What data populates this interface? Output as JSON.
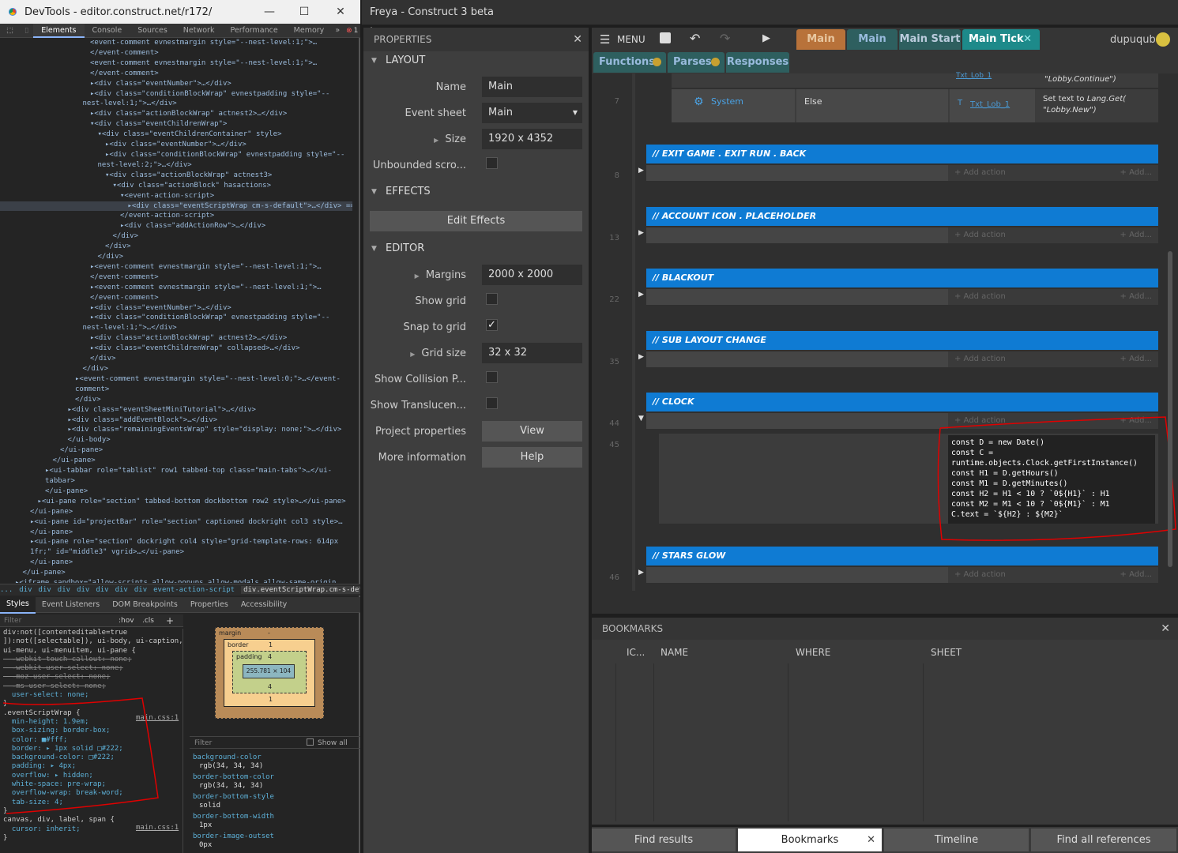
{
  "devtools": {
    "title": "DevTools - editor.construct.net/r172/",
    "tabs": [
      "Elements",
      "Console",
      "Sources",
      "Network",
      "Performance",
      "Memory",
      "»"
    ],
    "error_count": "1",
    "dom_lines": [
      {
        "i": 12,
        "t": "<event-comment evnestmargin style=\"--nest-level:1;\">…"
      },
      {
        "i": 12,
        "t": "</event-comment>"
      },
      {
        "i": 12,
        "t": "<event-comment evnestmargin style=\"--nest-level:1;\">…"
      },
      {
        "i": 12,
        "t": "</event-comment>"
      },
      {
        "i": 12,
        "t": "▸<div class=\"eventNumber\">…</div>"
      },
      {
        "i": 12,
        "t": "▸<div class=\"conditionBlockWrap\" evnestpadding style=\"--"
      },
      {
        "i": 11,
        "t": "nest-level:1;\">…</div>"
      },
      {
        "i": 12,
        "t": "▸<div class=\"actionBlockWrap\" actnest2>…</div>"
      },
      {
        "i": 12,
        "t": "▾<div class=\"eventChildrenWrap\">"
      },
      {
        "i": 13,
        "t": "▾<div class=\"eventChildrenContainer\" style>"
      },
      {
        "i": 14,
        "t": "▸<div class=\"eventNumber\">…</div>"
      },
      {
        "i": 14,
        "t": "▸<div class=\"conditionBlockWrap\" evnestpadding style=\"--"
      },
      {
        "i": 13,
        "t": "nest-level:2;\">…</div>"
      },
      {
        "i": 14,
        "t": "▾<div class=\"actionBlockWrap\" actnest3>"
      },
      {
        "i": 15,
        "t": "▾<div class=\"actionBlock\" hasactions>"
      },
      {
        "i": 16,
        "t": "▾<event-action-script>"
      },
      {
        "i": 17,
        "t": "▸<div class=\"eventScriptWrap cm-s-default\">…</div> =="
      },
      {
        "i": 16,
        "t": "</event-action-script>"
      },
      {
        "i": 16,
        "t": "▸<div class=\"addActionRow\">…</div>"
      },
      {
        "i": 15,
        "t": "</div>"
      },
      {
        "i": 14,
        "t": "</div>"
      },
      {
        "i": 13,
        "t": "</div>"
      },
      {
        "i": 12,
        "t": "▸<event-comment evnestmargin style=\"--nest-level:1;\">…"
      },
      {
        "i": 12,
        "t": "</event-comment>"
      },
      {
        "i": 12,
        "t": "▸<event-comment evnestmargin style=\"--nest-level:1;\">…"
      },
      {
        "i": 12,
        "t": "</event-comment>"
      },
      {
        "i": 12,
        "t": "▸<div class=\"eventNumber\">…</div>"
      },
      {
        "i": 12,
        "t": "▸<div class=\"conditionBlockWrap\" evnestpadding style=\"--"
      },
      {
        "i": 11,
        "t": "nest-level:1;\">…</div>"
      },
      {
        "i": 12,
        "t": "▸<div class=\"actionBlockWrap\" actnest2>…</div>"
      },
      {
        "i": 12,
        "t": "▸<div class=\"eventChildrenWrap\" collapsed>…</div>"
      },
      {
        "i": 12,
        "t": "</div>"
      },
      {
        "i": 11,
        "t": "</div>"
      },
      {
        "i": 10,
        "t": "▸<event-comment evnestmargin style=\"--nest-level:0;\">…</event-"
      },
      {
        "i": 10,
        "t": "comment>"
      },
      {
        "i": 10,
        "t": "</div>"
      },
      {
        "i": 9,
        "t": "▸<div class=\"eventSheetMiniTutorial\">…</div>"
      },
      {
        "i": 9,
        "t": "▸<div class=\"addEventBlock\">…</div>"
      },
      {
        "i": 9,
        "t": "▸<div class=\"remainingEventsWrap\" style=\"display: none;\">…</div>"
      },
      {
        "i": 9,
        "t": "</ui-body>"
      },
      {
        "i": 8,
        "t": "</ui-pane>"
      },
      {
        "i": 7,
        "t": "</ui-pane>"
      },
      {
        "i": 6,
        "t": "▸<ui-tabbar role=\"tablist\" row1 tabbed-top class=\"main-tabs\">…</ui-"
      },
      {
        "i": 6,
        "t": "tabbar>"
      },
      {
        "i": 6,
        "t": "</ui-pane>"
      },
      {
        "i": 5,
        "t": "▸<ui-pane role=\"section\" tabbed-bottom dockbottom row2 style>…</ui-pane>"
      },
      {
        "i": 4,
        "t": "</ui-pane>"
      },
      {
        "i": 4,
        "t": "▸<ui-pane id=\"projectBar\" role=\"section\" captioned dockright col3 style>…"
      },
      {
        "i": 4,
        "t": "</ui-pane>"
      },
      {
        "i": 4,
        "t": "▸<ui-pane role=\"section\" dockright col4 style=\"grid-template-rows: 614px"
      },
      {
        "i": 4,
        "t": "1fr;\" id=\"middle3\" vgrid>…</ui-pane>"
      },
      {
        "i": 4,
        "t": "</ui-pane>"
      },
      {
        "i": 3,
        "t": "</ui-pane>"
      },
      {
        "i": 2,
        "t": "▸<iframe sandbox=\"allow-scripts allow-popups allow-modals allow-same-origin"
      }
    ],
    "crumbs": [
      "...",
      "div",
      "div",
      "div",
      "div",
      "div",
      "div",
      "div",
      "event-action-script",
      "div.eventScriptWrap.cm-s-default"
    ],
    "style_tabs": [
      "Styles",
      "Event Listeners",
      "DOM Breakpoints",
      "Properties",
      "Accessibility"
    ],
    "filter_placeholder": "Filter",
    "hov": ":hov",
    "cls": ".cls",
    "style_lines": [
      "div:not([contenteditable=true",
      "]):not([selectable]), ui-body, ui-caption,",
      "ui-menu, ui-menuitem, ui-pane {",
      "  -webkit-touch-callout: none;",
      "  -webkit-user-select: none;",
      "  -moz-user-select: none;",
      "  -ms-user-select: none;",
      "  user-select: none;",
      "}",
      ".eventScriptWrap {",
      "  min-height: 1.9em;",
      "  box-sizing: border-box;",
      "  color: ■#fff;",
      "  border: ▸ 1px solid □#222;",
      "  background-color: □#222;",
      "  padding: ▸ 4px;",
      "  overflow: ▸ hidden;",
      "  white-space: pre-wrap;",
      "  overflow-wrap: break-word;",
      "  tab-size: 4;",
      "}",
      "canvas, div, label, span {",
      "  cursor: inherit;",
      "}"
    ],
    "main_css": "main.css:1",
    "box": {
      "margin": "margin",
      "border": "border",
      "padding": "padding",
      "padding_val": "4",
      "border_val": "1",
      "content": "255.781 × 104",
      "dash": "-"
    },
    "computed_filter": "Filter",
    "show_all": "Show all",
    "computed": [
      {
        "p": "background-color",
        "v": "rgb(34, 34, 34)"
      },
      {
        "p": "border-bottom-color",
        "v": "rgb(34, 34, 34)"
      },
      {
        "p": "border-bottom-style",
        "v": "solid"
      },
      {
        "p": "border-bottom-width",
        "v": "1px"
      },
      {
        "p": "border-image-outset",
        "v": "0px"
      }
    ]
  },
  "construct": {
    "title": "Freya - Construct 3 beta",
    "properties_title": "PROPERTIES",
    "sections": {
      "layout": "LAYOUT",
      "effects": "EFFECTS",
      "editor": "EDITOR"
    },
    "props": {
      "name_label": "Name",
      "name_val": "Main",
      "sheet_label": "Event sheet",
      "sheet_val": "Main",
      "size_label": "Size",
      "size_val": "1920 x 4352",
      "unbounded_label": "Unbounded scro...",
      "edit_effects": "Edit Effects",
      "margins_label": "Margins",
      "margins_val": "2000 x 2000",
      "showgrid_label": "Show grid",
      "snap_label": "Snap to grid",
      "gridsize_label": "Grid size",
      "gridsize_val": "32 x 32",
      "collision_label": "Show Collision P...",
      "transl_label": "Show Translucen...",
      "project_label": "Project properties",
      "view_btn": "View",
      "more_label": "More information",
      "help_btn": "Help"
    },
    "menu": "MENU",
    "user": "dupuqub",
    "top_tabs": [
      "Main",
      "Main",
      "Main Start",
      "Main Tick"
    ],
    "sub_tabs": [
      "Functions",
      "Parses",
      "Responses"
    ],
    "rows": {
      "lobby_continue": "\"Lobby.Continue\")",
      "txt_lob_top": "Txt_Lob_1",
      "row7": "7",
      "system": "System",
      "else": "Else",
      "txt_lob": "Txt_Lob_1",
      "set_text": "Set text to ",
      "lang": "Lang.Get(",
      "lobby_new": "\"Lobby.New\")"
    },
    "events": [
      {
        "title": "EXIT GAME . EXIT RUN . BACK",
        "num": "8"
      },
      {
        "title": "ACCOUNT ICON . PLACEHOLDER",
        "num": "13"
      },
      {
        "title": "BLACKOUT",
        "num": "22"
      },
      {
        "title": "SUB LAYOUT CHANGE",
        "num": "35"
      },
      {
        "title": "CLOCK",
        "num": "44"
      },
      {
        "title": "STARS GLOW",
        "num": "46"
      }
    ],
    "clock_sub_num": "45",
    "add_action": "+ Add action",
    "add_short": "+ Add...",
    "code_lines": [
      "const D = new Date()",
      "const C =",
      "runtime.objects.Clock.getFirstInstance()",
      "const H1 = D.getHours()",
      "const M1 = D.getMinutes()",
      "const H2 = H1 < 10 ? `0${H1}` : H1",
      "const M2 = M1 < 10 ? `0${M1}` : M1",
      "C.text = `${H2} : ${M2}`"
    ],
    "bookmarks_title": "BOOKMARKS",
    "bm_cols": [
      "IC...",
      "NAME",
      "WHERE",
      "SHEET"
    ],
    "bottom_tabs": [
      "Find results",
      "Bookmarks",
      "Timeline",
      "Find all references"
    ]
  },
  "colors": {
    "accent": "#0f7bd3",
    "orange_tab": "#c27a37",
    "teal_tab": "#2a6b6b",
    "annotation": "#e00000"
  }
}
